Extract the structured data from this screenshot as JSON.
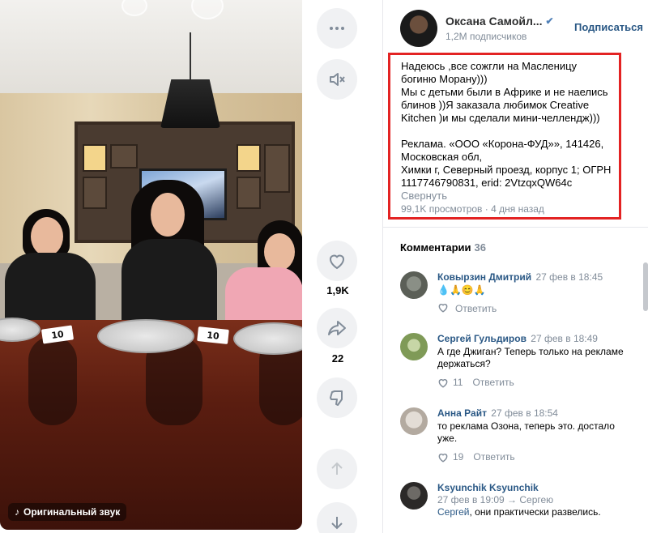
{
  "video": {
    "plate_cards": [
      "10",
      "10"
    ],
    "original_sound_label": "Оригинальный звук"
  },
  "actions": {
    "likes": "1,9K",
    "shares": "22"
  },
  "author": {
    "name": "Оксана Самойл...",
    "subscribers": "1,2M подписчиков",
    "subscribe_label": "Подписаться"
  },
  "description": {
    "text": "Надеюсь ,все сожгли на Масленицу богиню Морану)))\nМы с детьми были в Африке и не наелись блинов ))Я заказала любимок Creative Kitchen )и мы сделали мини-челлендж)))\n\nРеклама. «ООО «Корона-ФУД»», 141426, Московская обл,\nХимки г, Северный проезд, корпус 1; ОГРН 1117746790831, erid: 2VtzqxQW64c",
    "collapse_label": "Свернуть",
    "views": "99,1K просмотров",
    "posted": "4 дня назад"
  },
  "comments": {
    "title": "Комментарии",
    "count": "36",
    "items": [
      {
        "author": "Ковырзин Дмитрий",
        "date": "27 фев в 18:45",
        "text": "💧🙏😊🙏",
        "likes": "",
        "reply_label": "Ответить"
      },
      {
        "author": "Сергей Гульдиров",
        "date": "27 фев в 18:49",
        "text": "А где Джиган? Теперь только на рекламе держаться?",
        "likes": "11",
        "reply_label": "Ответить"
      },
      {
        "author": "Анна Райт",
        "date": "27 фев в 18:54",
        "text": "то реклама Озона, теперь это. достало уже.",
        "likes": "19",
        "reply_label": "Ответить"
      },
      {
        "author": "Ksyunchik Ksyunchik",
        "date": "27 фев в 19:09",
        "reply_to": "Сергею",
        "mention": "Сергей",
        "text": ", они практически развелись."
      }
    ]
  },
  "colors": {
    "link": "#2a5885",
    "muted": "#818c99",
    "highlight_border": "#e32323",
    "button_bg": "#f0f1f3"
  }
}
